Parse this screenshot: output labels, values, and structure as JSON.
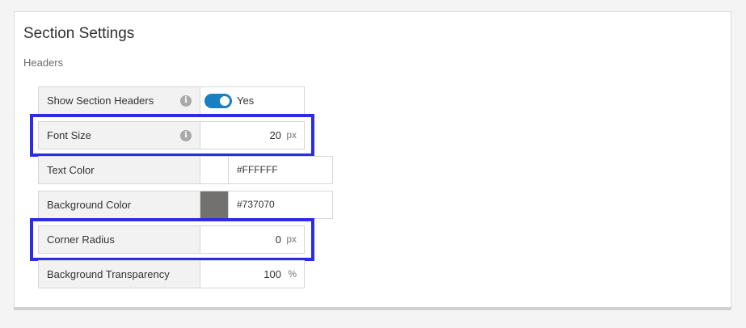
{
  "section": {
    "title": "Section Settings",
    "group_label": "Headers"
  },
  "rows": {
    "show_headers": {
      "label": "Show Section Headers",
      "toggle_on": true,
      "toggle_text": "Yes",
      "info_icon": "info-icon"
    },
    "font_size": {
      "label": "Font Size",
      "value": "20",
      "unit": "px",
      "info_icon": "info-icon"
    },
    "text_color": {
      "label": "Text Color",
      "hex": "#FFFFFF",
      "swatch": "#FFFFFF"
    },
    "background_color": {
      "label": "Background Color",
      "hex": "#737070",
      "swatch": "#737070"
    },
    "corner_radius": {
      "label": "Corner Radius",
      "value": "0",
      "unit": "px"
    },
    "background_transparency": {
      "label": "Background Transparency",
      "value": "100",
      "unit": "%"
    }
  },
  "highlight_color": "#2B2BE8",
  "accent_color": "#1A7FC1"
}
